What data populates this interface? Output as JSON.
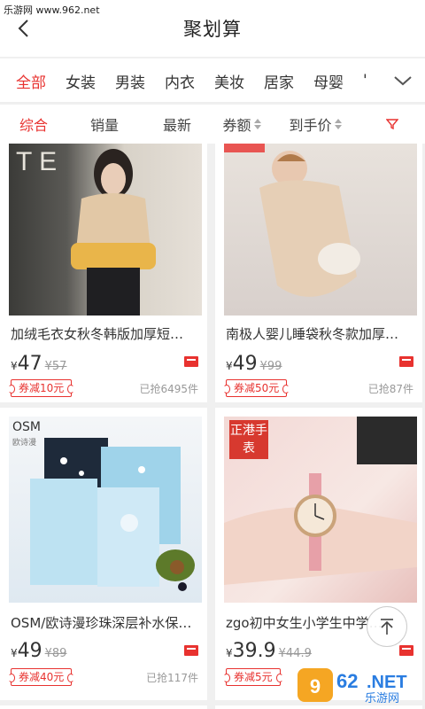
{
  "watermark": "乐游网 www.962.net",
  "header": {
    "title": "聚划算"
  },
  "categories": [
    "全部",
    "女装",
    "男装",
    "内衣",
    "美妆",
    "居家",
    "母婴",
    "'"
  ],
  "sort": {
    "items": [
      "综合",
      "销量",
      "最新",
      "券额",
      "到手价"
    ]
  },
  "products": [
    {
      "title": "加绒毛衣女秋冬韩版加厚短…",
      "currency": "¥",
      "price": "47",
      "orig": "¥57",
      "coupon": "券减10元",
      "sold": "已抢6495件"
    },
    {
      "title": "南极人婴儿睡袋秋冬款加厚…",
      "currency": "¥",
      "price": "49",
      "orig": "¥99",
      "coupon": "券减50元",
      "sold": "已抢87件"
    },
    {
      "title": "OSM/欧诗漫珍珠深层补水保…",
      "currency": "¥",
      "price": "49",
      "orig": "¥89",
      "coupon": "券减40元",
      "sold": "已抢117件"
    },
    {
      "title": "zgo初中女生小学生中学…",
      "currency": "¥",
      "price": "39.9",
      "orig": "¥44.9",
      "coupon": "券减5元",
      "sold": ""
    }
  ],
  "images": {
    "osm_brand": "OSM",
    "osm_sub": "欧诗漫",
    "watch_badge": "正港手表"
  },
  "colors": {
    "accent": "#e8322f"
  }
}
